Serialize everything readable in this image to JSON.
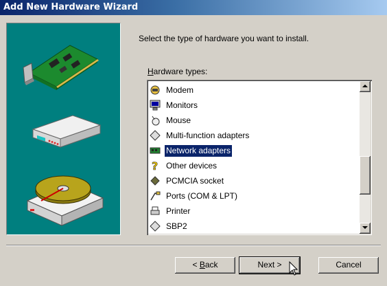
{
  "window": {
    "title": "Add New Hardware Wizard"
  },
  "main": {
    "instruction": "Select the type of hardware you want to install.",
    "hardware_label_prefix": "H",
    "hardware_label_rest": "ardware types:"
  },
  "hardware_types": [
    {
      "label": "Modem",
      "icon": "modem-icon",
      "selected": false
    },
    {
      "label": "Monitors",
      "icon": "monitor-icon",
      "selected": false
    },
    {
      "label": "Mouse",
      "icon": "mouse-icon",
      "selected": false
    },
    {
      "label": "Multi-function adapters",
      "icon": "multifunction-adapter-icon",
      "selected": false
    },
    {
      "label": "Network adapters",
      "icon": "network-adapter-icon",
      "selected": true
    },
    {
      "label": "Other devices",
      "icon": "question-mark-icon",
      "selected": false
    },
    {
      "label": "PCMCIA socket",
      "icon": "pcmcia-socket-icon",
      "selected": false
    },
    {
      "label": "Ports (COM & LPT)",
      "icon": "ports-icon",
      "selected": false
    },
    {
      "label": "Printer",
      "icon": "printer-icon",
      "selected": false
    },
    {
      "label": "SBP2",
      "icon": "sbp2-icon",
      "selected": false
    }
  ],
  "buttons": {
    "back_prefix": "< ",
    "back_key": "B",
    "back_rest": "ack",
    "next": "Next >",
    "cancel": "Cancel"
  },
  "colors": {
    "title_active": "#0a246a",
    "selection": "#0a246a",
    "art_bg": "#007f7f",
    "face": "#d4d0c8"
  }
}
